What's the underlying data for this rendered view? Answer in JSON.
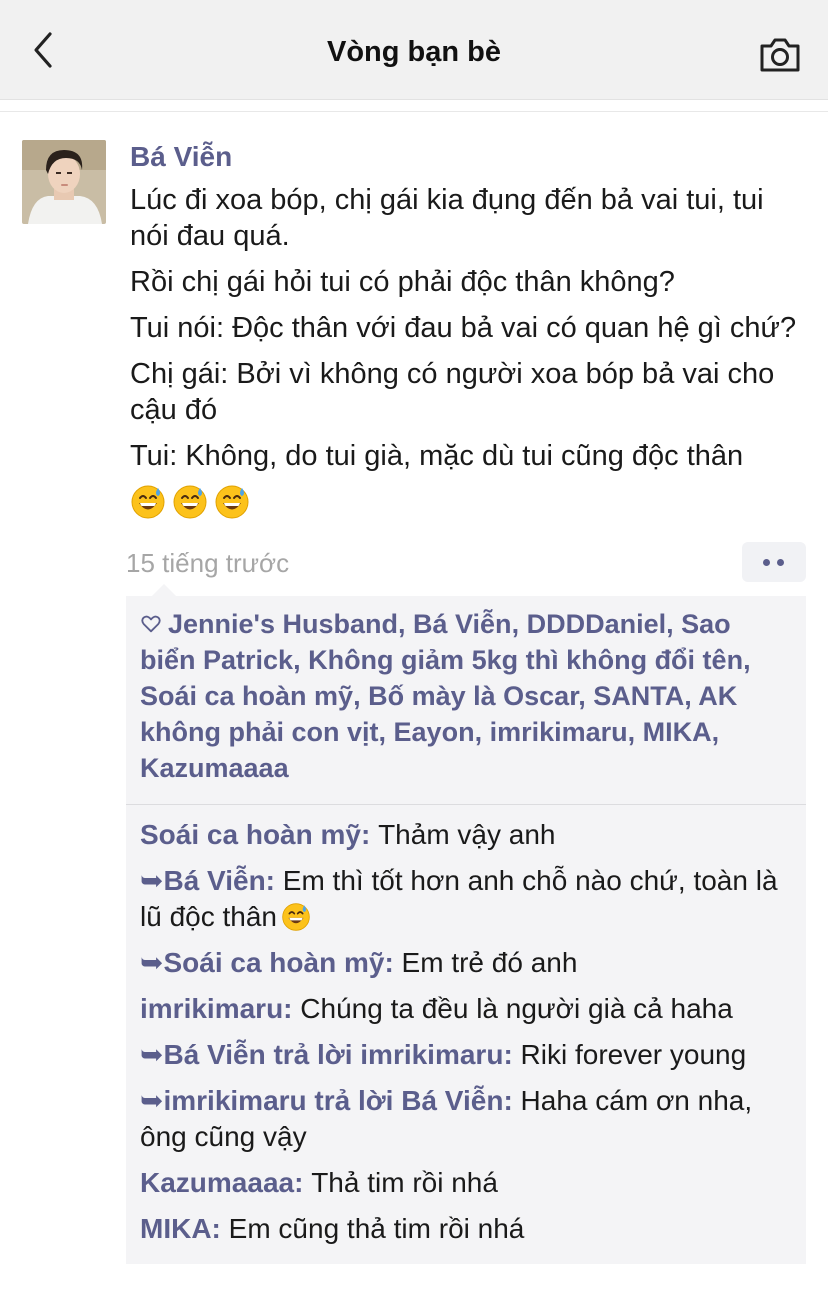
{
  "header": {
    "title": "Vòng bạn bè",
    "back_icon": "chevron-left-icon",
    "camera_icon": "camera-icon"
  },
  "post": {
    "author": "Bá Viễn",
    "lines": [
      "Lúc đi xoa bóp, chị gái kia đụng đến bả vai tui, tui nói đau quá.",
      "Rồi chị gái hỏi tui có phải độc thân không?",
      "Tui nói: Độc thân với đau bả vai có quan hệ gì chứ?",
      "Chị gái: Bởi vì không có người xoa bóp bả vai cho cậu đó",
      "Tui: Không, do tui già, mặc dù tui cũng độc thân"
    ],
    "emojis": [
      "grinning-sweat-emoji",
      "grinning-sweat-emoji",
      "grinning-sweat-emoji"
    ],
    "time": "15 tiếng trước"
  },
  "likes": {
    "icon": "heart-outline-icon",
    "names": [
      "Jennie's Husband",
      "Bá Viễn",
      "DDDDaniel",
      "Sao biển Patrick",
      "Không giảm 5kg thì không đổi tên",
      "Soái ca hoàn mỹ",
      "Bố mày là Oscar",
      "SANTA",
      "AK không phải con vịt",
      "Eayon",
      "imrikimaru",
      "MIKA",
      "Kazumaaaa"
    ]
  },
  "comments": [
    {
      "prefix": "",
      "name": "Soái ca hoàn mỹ",
      "text": "Thảm vậy anh"
    },
    {
      "prefix": "➥",
      "name": "Bá Viễn",
      "text": "Em thì tốt hơn anh chỗ nào chứ, toàn là lũ độc thân"
    },
    {
      "prefix": "➥",
      "name": "Soái ca hoàn mỹ",
      "text": "Em trẻ đó anh"
    },
    {
      "prefix": "",
      "name": "imrikimaru",
      "text": "Chúng ta đều là người già cả haha"
    },
    {
      "prefix": "➥",
      "name": "Bá Viễn trả lời imrikimaru",
      "text": "Riki forever young"
    },
    {
      "prefix": "➥",
      "name": "imrikimaru trả lời Bá Viễn",
      "text": "Haha cám ơn nha, ông cũng vậy"
    },
    {
      "prefix": "",
      "name": "Kazumaaaa",
      "text": "Thả tim rồi nhá"
    },
    {
      "prefix": "",
      "name": "MIKA",
      "text": "Em cũng thả tim rồi nhá"
    }
  ],
  "colors": {
    "name_accent": "#5b5e8c",
    "header_bg": "#f1f1f1",
    "comment_bg": "#f4f4f6",
    "time": "#a6a6a6"
  }
}
